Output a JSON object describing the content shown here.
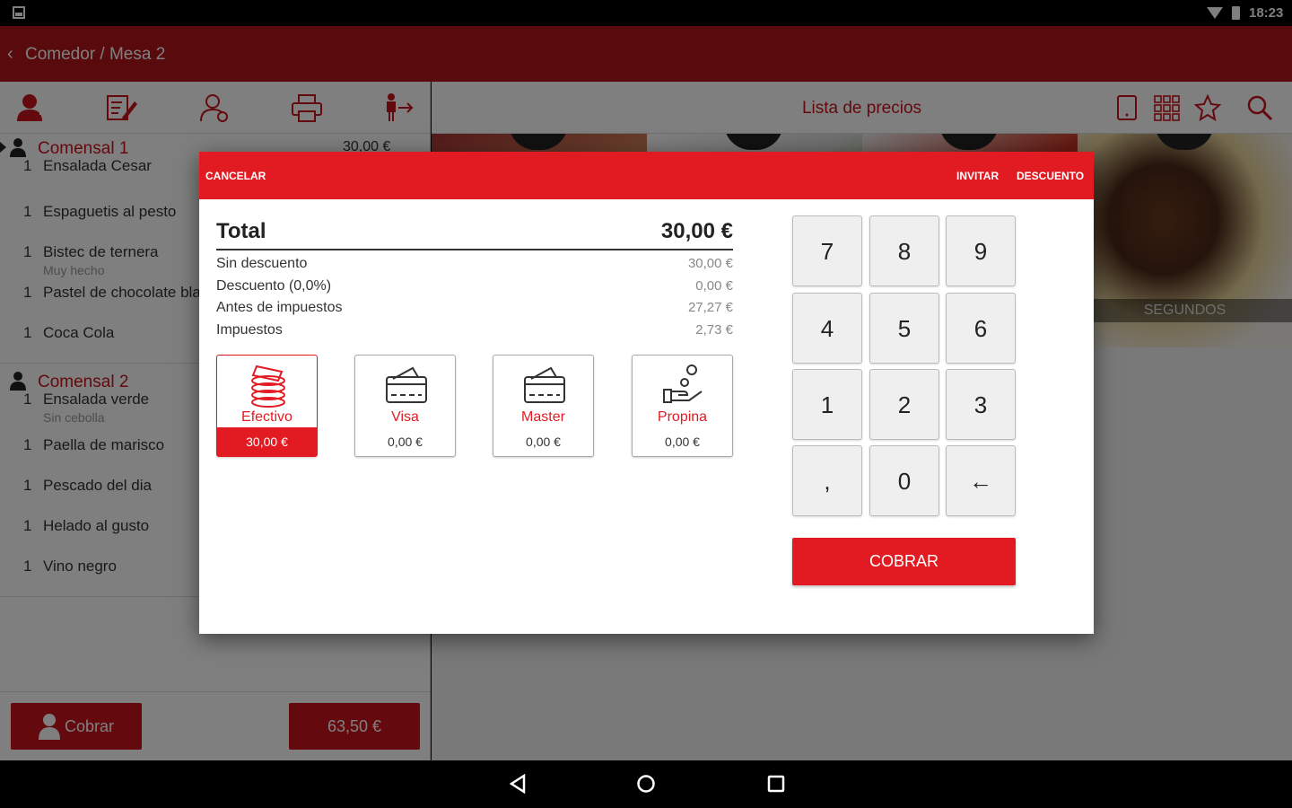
{
  "status_bar": {
    "time": "18:23"
  },
  "app_bar": {
    "breadcrumb": "Comedor / Mesa 2"
  },
  "left_panel": {
    "guests": [
      {
        "name": "Comensal 1",
        "amount": "30,00 €",
        "items": [
          {
            "qty": "1",
            "name": "Ensalada Cesar",
            "note": ""
          },
          {
            "qty": "1",
            "name": "Espaguetis al pesto",
            "note": ""
          },
          {
            "qty": "1",
            "name": "Bistec de ternera",
            "note": "Muy hecho"
          },
          {
            "qty": "1",
            "name": "Pastel de chocolate blanco",
            "note": ""
          },
          {
            "qty": "1",
            "name": "Coca Cola",
            "note": ""
          }
        ]
      },
      {
        "name": "Comensal 2",
        "amount": "",
        "items": [
          {
            "qty": "1",
            "name": "Ensalada verde",
            "note": "Sin cebolla"
          },
          {
            "qty": "1",
            "name": "Paella de marisco",
            "note": ""
          },
          {
            "qty": "1",
            "name": "Pescado del dia",
            "note": ""
          },
          {
            "qty": "1",
            "name": "Helado al gusto",
            "note": ""
          },
          {
            "qty": "1",
            "name": "Vino negro",
            "note": ""
          }
        ]
      }
    ],
    "footer": {
      "charge_label": "Cobrar",
      "total_label": "63,50 €"
    }
  },
  "right_panel": {
    "title": "Lista de precios",
    "tiles": [
      {
        "caption": ""
      },
      {
        "caption": ""
      },
      {
        "caption": ""
      },
      {
        "caption": "SEGUNDOS"
      }
    ]
  },
  "dialog": {
    "actions": {
      "cancel": "CANCELAR",
      "invite": "INVITAR",
      "discount": "DESCUENTO"
    },
    "summary": {
      "total_label": "Total",
      "total_value": "30,00 €",
      "rows": [
        {
          "label": "Sin descuento",
          "value": "30,00 €"
        },
        {
          "label": "Descuento (0,0%)",
          "value": "0,00 €"
        },
        {
          "label": "Antes de impuestos",
          "value": "27,27 €"
        },
        {
          "label": "Impuestos",
          "value": "2,73 €"
        }
      ]
    },
    "payment_methods": [
      {
        "name": "Efectivo",
        "amount": "30,00 €",
        "icon": "cash-stack-icon",
        "selected": true
      },
      {
        "name": "Visa",
        "amount": "0,00 €",
        "icon": "credit-card-icon",
        "selected": false
      },
      {
        "name": "Master",
        "amount": "0,00 €",
        "icon": "credit-card-icon",
        "selected": false
      },
      {
        "name": "Propina",
        "amount": "0,00 €",
        "icon": "tip-hand-icon",
        "selected": false
      }
    ],
    "keypad": [
      "7",
      "8",
      "9",
      "4",
      "5",
      "6",
      "1",
      "2",
      "3",
      ",",
      "0",
      "←"
    ],
    "charge_button": "COBRAR"
  },
  "colors": {
    "brand_dark": "#b0141b",
    "accent": "#e21b23"
  }
}
